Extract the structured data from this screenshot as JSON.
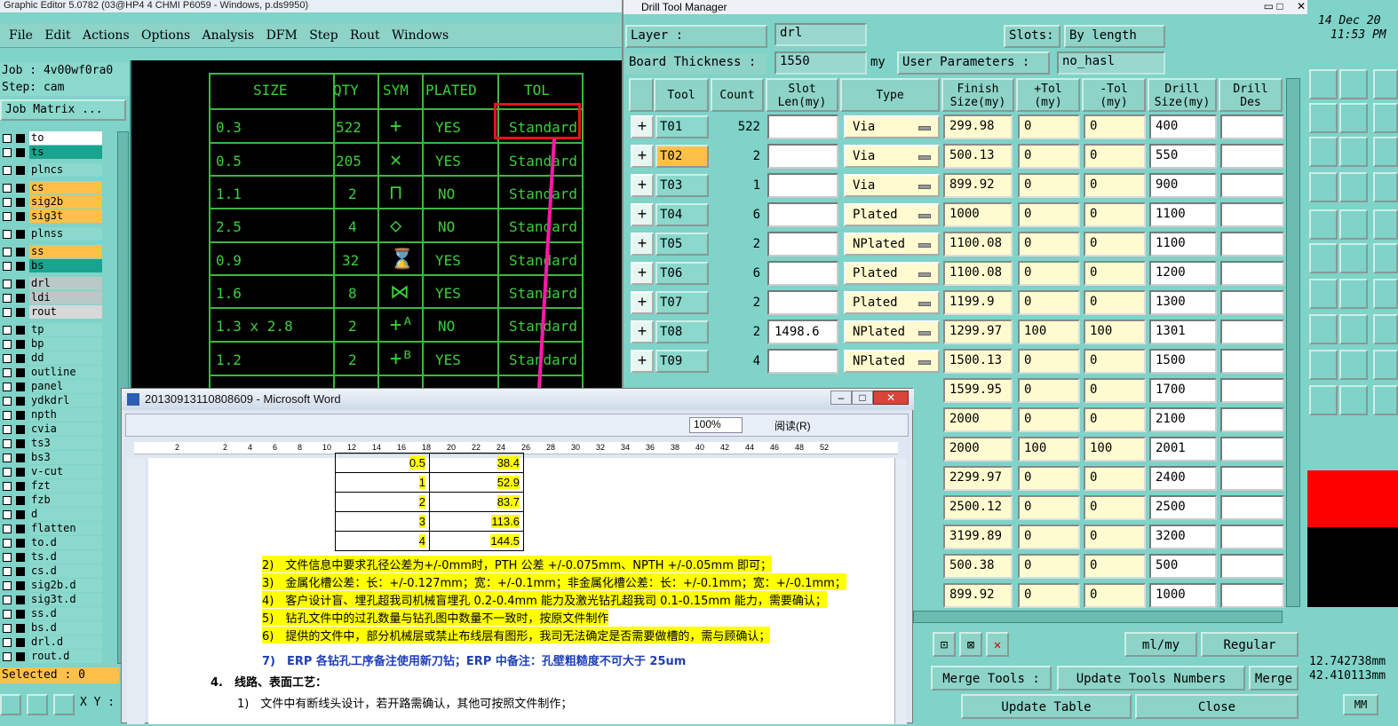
{
  "app": {
    "title": "Graphic Editor 5.0782 (03@HP4 4 CHMI P6059 - Windows, p.ds9950)",
    "menu": [
      "File",
      "Edit",
      "Actions",
      "Options",
      "Analysis",
      "DFM",
      "Step",
      "Rout",
      "Windows"
    ]
  },
  "job": {
    "job": "Job : 4v00wf0ra0",
    "step": "Step: cam",
    "matrix": "Job Matrix ...",
    "selected": "Selected : 0",
    "xy": "X Y :"
  },
  "layers": [
    "to",
    "ts",
    "plncs",
    "cs",
    "sig2b",
    "sig3t",
    "plnss",
    "ss",
    "bs",
    "drl",
    "ldi",
    "rout",
    "tp",
    "bp",
    "dd",
    "outline",
    "panel",
    "ydkdrl",
    "npth",
    "cvia",
    "ts3",
    "bs3",
    "v-cut",
    "fzt",
    "fzb",
    "d",
    "flatten",
    "to.d",
    "ts.d",
    "cs.d",
    "sig2b.d",
    "sig3t.d",
    "ss.d",
    "bs.d",
    "drl.d",
    "rout.d"
  ],
  "graphic": {
    "headers": [
      "SIZE",
      "QTY",
      "SYM",
      "PLATED",
      "TOL"
    ],
    "rows": [
      [
        "0.3",
        "522",
        "YES",
        "Standard"
      ],
      [
        "0.5",
        "205",
        "YES",
        "Standard"
      ],
      [
        "1.1",
        "2",
        "NO",
        "Standard"
      ],
      [
        "2.5",
        "4",
        "NO",
        "Standard"
      ],
      [
        "0.9",
        "32",
        "YES",
        "Standard"
      ],
      [
        "1.6",
        "8",
        "YES",
        "Standard"
      ],
      [
        "1.3 x 2.8",
        "2",
        "NO",
        "Standard"
      ],
      [
        "1.2",
        "2",
        "YES",
        "Standard"
      ]
    ]
  },
  "dtm": {
    "title": "Drill Tool Manager",
    "layer_label": "Layer :",
    "layer_value": "drl",
    "slots_label": "Slots:",
    "slots_value": "By length",
    "thick_label": "Board Thickness :",
    "thick_value": "1550",
    "thick_unit": "my",
    "user_params_label": "User Parameters :",
    "user_params_value": "no_hasl",
    "headers": [
      "Tool",
      "Count",
      "Slot Len(my)",
      "Type",
      "Finish Size(my)",
      "+Tol (my)",
      "-Tol (my)",
      "Drill Size(my)",
      "Drill Des"
    ],
    "rows": [
      {
        "tool": "T01",
        "count": "522",
        "slot": "",
        "type": "Via",
        "finish": "299.98",
        "ptol": "0",
        "ntol": "0",
        "drill": "400"
      },
      {
        "tool": "T02",
        "count": "2",
        "slot": "",
        "type": "Via",
        "finish": "500.13",
        "ptol": "0",
        "ntol": "0",
        "drill": "550"
      },
      {
        "tool": "T03",
        "count": "1",
        "slot": "",
        "type": "Via",
        "finish": "899.92",
        "ptol": "0",
        "ntol": "0",
        "drill": "900"
      },
      {
        "tool": "T04",
        "count": "6",
        "slot": "",
        "type": "Plated",
        "finish": "1000",
        "ptol": "0",
        "ntol": "0",
        "drill": "1100"
      },
      {
        "tool": "T05",
        "count": "2",
        "slot": "",
        "type": "NPlated",
        "finish": "1100.08",
        "ptol": "0",
        "ntol": "0",
        "drill": "1100"
      },
      {
        "tool": "T06",
        "count": "6",
        "slot": "",
        "type": "Plated",
        "finish": "1100.08",
        "ptol": "0",
        "ntol": "0",
        "drill": "1200"
      },
      {
        "tool": "T07",
        "count": "2",
        "slot": "",
        "type": "Plated",
        "finish": "1199.9",
        "ptol": "0",
        "ntol": "0",
        "drill": "1300"
      },
      {
        "tool": "T08",
        "count": "2",
        "slot": "1498.6",
        "type": "NPlated",
        "finish": "1299.97",
        "ptol": "100",
        "ntol": "100",
        "drill": "1301"
      },
      {
        "tool": "T09",
        "count": "4",
        "slot": "",
        "type": "NPlated",
        "finish": "1500.13",
        "ptol": "0",
        "ntol": "0",
        "drill": "1500"
      },
      {
        "finish": "1599.95",
        "ptol": "0",
        "ntol": "0",
        "drill": "1700"
      },
      {
        "finish": "2000",
        "ptol": "0",
        "ntol": "0",
        "drill": "2100"
      },
      {
        "finish": "2000",
        "ptol": "100",
        "ntol": "100",
        "drill": "2001"
      },
      {
        "finish": "2299.97",
        "ptol": "0",
        "ntol": "0",
        "drill": "2400"
      },
      {
        "finish": "2500.12",
        "ptol": "0",
        "ntol": "0",
        "drill": "2500"
      },
      {
        "finish": "3199.89",
        "ptol": "0",
        "ntol": "0",
        "drill": "3200"
      },
      {
        "finish": "500.38",
        "ptol": "0",
        "ntol": "0",
        "drill": "500"
      },
      {
        "finish": "899.92",
        "ptol": "0",
        "ntol": "0",
        "drill": "1000"
      }
    ],
    "units": "ml/my",
    "mode": "Regular",
    "merge_tools": "Merge Tools :",
    "update_numbers": "Update Tools Numbers",
    "merge": "Merge",
    "update_table": "Update Table",
    "close": "Close"
  },
  "right": {
    "date": "14 Dec 20",
    "time": "11:53 PM",
    "coord1": "12.742738mm",
    "coord2": "42.410113mm",
    "unit": "MM"
  },
  "word": {
    "title": "20130913110808609 - Microsoft Word",
    "zoom": "100%",
    "read": "阅读(R)",
    "ruler": [
      "2",
      "2",
      "4",
      "6",
      "8",
      "10",
      "12",
      "14",
      "16",
      "18",
      "20",
      "22",
      "24",
      "26",
      "28",
      "30",
      "32",
      "34",
      "36",
      "38",
      "40",
      "42",
      "44",
      "46",
      "48",
      "52"
    ],
    "table": [
      [
        "0.5",
        "38.4"
      ],
      [
        "1",
        "52.9"
      ],
      [
        "2",
        "83.7"
      ],
      [
        "3",
        "113.6"
      ],
      [
        "4",
        "144.5"
      ]
    ],
    "lines": [
      "2)　文件信息中要求孔径公差为+/-0mm时，PTH 公差 +/-0.075mm、NPTH +/-0.05mm 即可；",
      "3)　金属化槽公差：长：+/-0.127mm；宽：+/-0.1mm；非金属化槽公差：长：+/-0.1mm；宽：+/-0.1mm；",
      "4)　客户设计盲、埋孔超我司机械盲埋孔 0.2-0.4mm 能力及激光钻孔超我司 0.1-0.15mm 能力，需要确认；",
      "5)　钻孔文件中的过孔数量与钻孔图中数量不一致时，按原文件制作",
      "6)　提供的文件中，部分机械层或禁止布线层有图形，我司无法确定是否需要做槽的，需与顾确认；",
      "7)　ERP 各钻孔工序备注使用新刀钻；ERP 中备注：孔壁粗糙度不可大于 25um",
      "4.　线路、表面工艺：",
      "1)　文件中有断线头设计，若开路需确认，其他可按照文件制作；"
    ]
  }
}
